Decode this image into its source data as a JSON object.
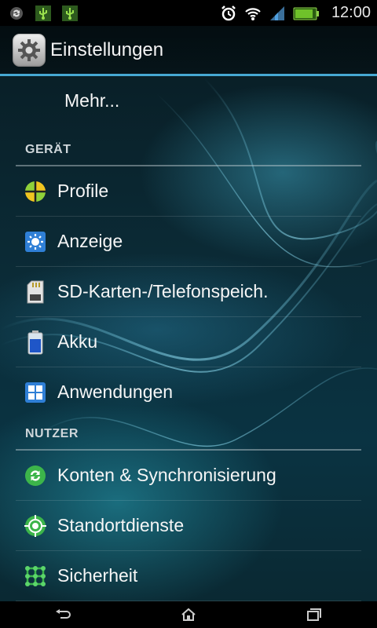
{
  "status_bar": {
    "time": "12:00",
    "battery_level": "80",
    "left_icons": [
      "sync-icon",
      "usb-icon",
      "usb-debug-icon"
    ],
    "right_icons": [
      "alarm-icon",
      "wifi-icon",
      "signal-icon",
      "battery-icon"
    ]
  },
  "action_bar": {
    "title": "Einstellungen",
    "icon": "settings-gear-icon"
  },
  "list": {
    "more": "Mehr...",
    "section_device": "GERÄT",
    "profiles": "Profile",
    "display": "Anzeige",
    "storage": "SD-Karten-/Telefonspeich.",
    "battery": "Akku",
    "apps": "Anwendungen",
    "section_user": "NUTZER",
    "accounts": "Konten & Synchronisierung",
    "location": "Standortdienste",
    "security": "Sicherheit"
  },
  "colors": {
    "accent": "#47a9d3",
    "header_text": "#cfd6da",
    "icon_green": "#3cb54a",
    "icon_blue": "#2f7fd6"
  },
  "nav_bar": {
    "icons": [
      "back-icon",
      "home-icon",
      "recent-apps-icon"
    ]
  }
}
